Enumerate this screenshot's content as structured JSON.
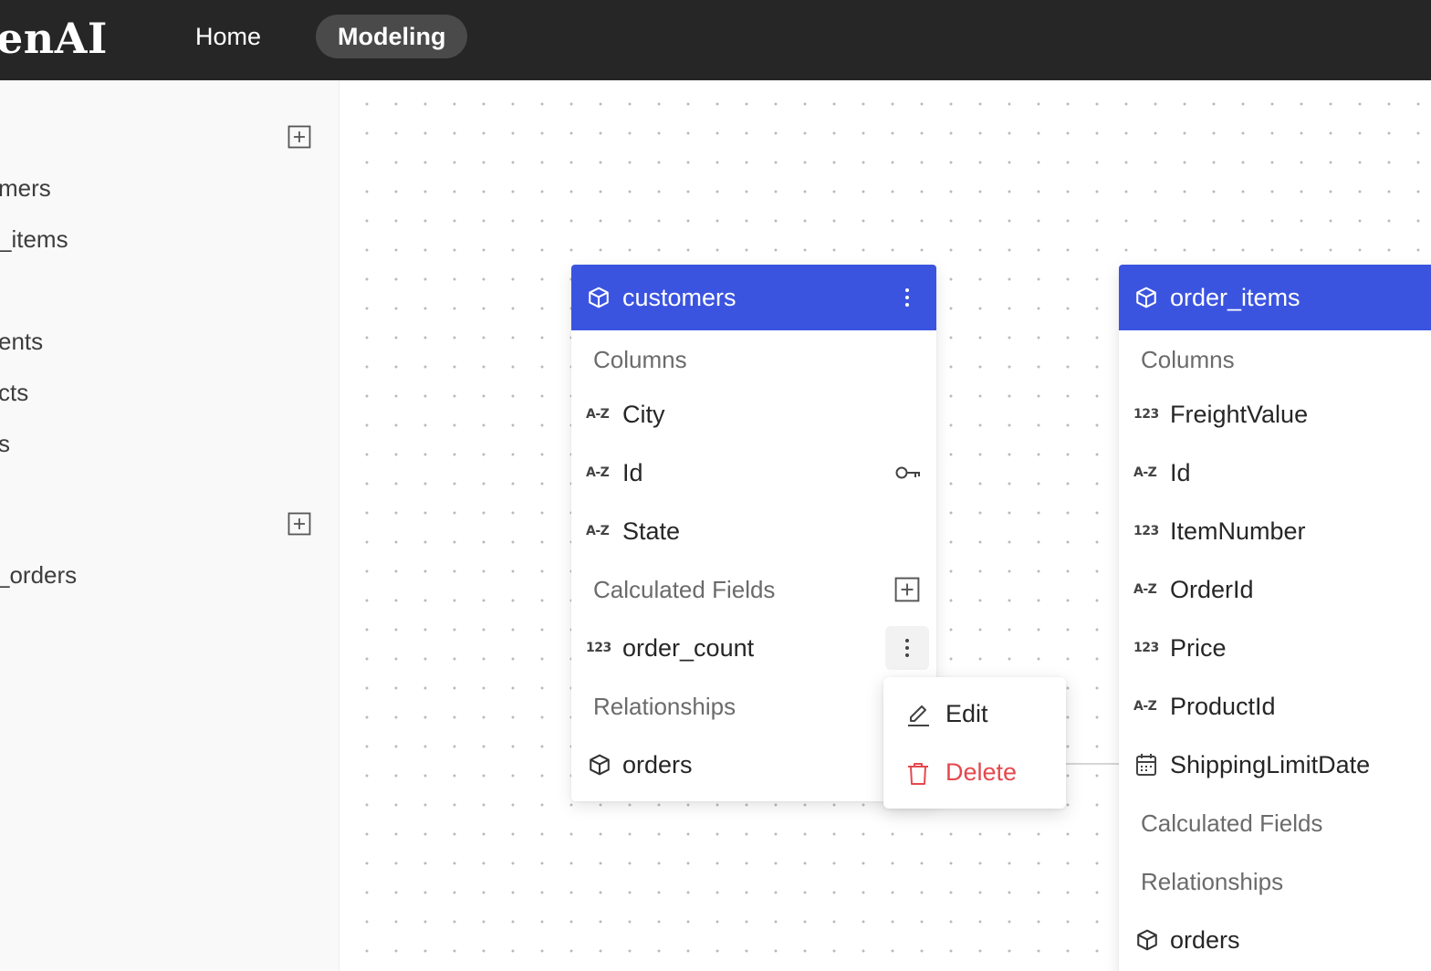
{
  "header": {
    "logo": "enAI",
    "nav": [
      {
        "label": "Home",
        "active": false
      },
      {
        "label": "Modeling",
        "active": true
      }
    ]
  },
  "sidebar": {
    "items": [
      "mers",
      "_items",
      "ents",
      "cts",
      "s",
      "_orders"
    ]
  },
  "models": {
    "customers": {
      "title": "customers",
      "columns_label": "Columns",
      "columns": [
        {
          "type": "A-Z",
          "name": "City",
          "primary_key": false
        },
        {
          "type": "A-Z",
          "name": "Id",
          "primary_key": true
        },
        {
          "type": "A-Z",
          "name": "State",
          "primary_key": false
        }
      ],
      "calculated_label": "Calculated Fields",
      "calculated": [
        {
          "type": "123",
          "name": "order_count"
        }
      ],
      "relationships_label": "Relationships",
      "relationships": [
        {
          "name": "orders"
        }
      ]
    },
    "order_items": {
      "title": "order_items",
      "columns_label": "Columns",
      "columns": [
        {
          "type": "123",
          "name": "FreightValue"
        },
        {
          "type": "A-Z",
          "name": "Id"
        },
        {
          "type": "123",
          "name": "ItemNumber"
        },
        {
          "type": "A-Z",
          "name": "OrderId"
        },
        {
          "type": "123",
          "name": "Price"
        },
        {
          "type": "A-Z",
          "name": "ProductId"
        },
        {
          "type": "calendar-icon",
          "name": "ShippingLimitDate"
        }
      ],
      "calculated_label": "Calculated Fields",
      "relationships_label": "Relationships",
      "relationships": [
        {
          "name": "orders"
        }
      ]
    }
  },
  "context_menu": {
    "edit": "Edit",
    "delete": "Delete",
    "delete_color": "#e5484d"
  },
  "colors": {
    "header_bg": "#262626",
    "model_header": "#3b54e0",
    "active_nav": "#4a4a4a"
  }
}
